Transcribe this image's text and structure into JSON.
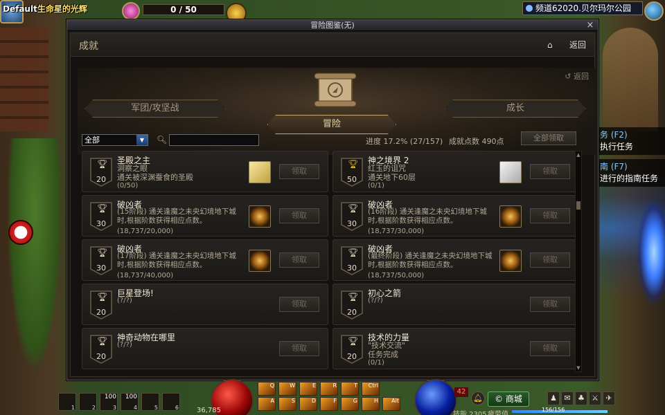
{
  "hud": {
    "player_prefix": "Default",
    "player_name": "生命星的光辉",
    "fatigue_counter": "0 / 50",
    "channel": "频道62020.贝尔玛尔公园",
    "quest_panel": {
      "title": "务 (F2)",
      "text": "执行任务"
    },
    "guide_panel": {
      "title": "南 (F7)",
      "text": "进行的指南任务"
    }
  },
  "window": {
    "title": "冒险图鉴(无)",
    "close": "×",
    "section_title": "成就",
    "back": "返回",
    "back_small": "返回",
    "tabs": {
      "left": "军团/攻坚战",
      "active": "冒险",
      "right": "成长"
    },
    "filter": {
      "selected": "全部",
      "search_placeholder": "",
      "progress": "进度 17.2% (27/157)",
      "points": "成就点数 490点",
      "claim_all": "全部领取"
    },
    "cards": [
      {
        "points": "20",
        "gold": false,
        "title": "圣殿之主",
        "desc": "洞察之眼\n通关被深渊蚕食的圣殿",
        "progress": "(0/50)",
        "reward": "box",
        "claim": "领取"
      },
      {
        "points": "50",
        "gold": true,
        "title": "神之境界 2",
        "desc": "红玉的诅咒\n通关地下60层",
        "progress": "(0/1)",
        "reward": "paper",
        "claim": "领取"
      },
      {
        "points": "30",
        "gold": false,
        "title": "破凶者",
        "desc": "(15阶段) 通关逢魔之未央幻境地下城时,根据阶数获得相应点数。",
        "progress": "(18,737/20,000)",
        "reward": "gear",
        "claim": "领取"
      },
      {
        "points": "30",
        "gold": false,
        "title": "破凶者",
        "desc": "(16阶段) 通关逢魔之未央幻境地下城时,根据阶数获得相应点数。",
        "progress": "(18,737/30,000)",
        "reward": "gear",
        "claim": "领取"
      },
      {
        "points": "30",
        "gold": false,
        "title": "破凶者",
        "desc": "(17阶段) 通关逢魔之未央幻境地下城时,根据阶数获得相应点数。",
        "progress": "(18,737/40,000)",
        "reward": "gear",
        "claim": "领取"
      },
      {
        "points": "30",
        "gold": false,
        "title": "破凶者",
        "desc": "(最终阶段) 通关逢魔之未央幻境地下城时,根据阶数获得相应点数。",
        "progress": "(18,737/50,000)",
        "reward": "gear",
        "claim": "领取"
      },
      {
        "points": "20",
        "gold": false,
        "title": "巨星登场!",
        "desc": "",
        "progress": "(?/?)",
        "reward": "",
        "claim": "领取"
      },
      {
        "points": "20",
        "gold": false,
        "title": "初心之箭",
        "desc": "",
        "progress": "(?/?)",
        "reward": "",
        "claim": "领取"
      },
      {
        "points": "20",
        "gold": false,
        "title": "神奇动物在哪里",
        "desc": "",
        "progress": "(?/?)",
        "reward": "",
        "claim": "领取"
      },
      {
        "points": "20",
        "gold": false,
        "title": "技术的力量",
        "desc": "\"技术交流\"\n任务完成",
        "progress": "(0/1)",
        "reward": "",
        "claim": "领取"
      }
    ]
  },
  "bottom_hud": {
    "slots": [
      {
        "qty": "",
        "key": "1"
      },
      {
        "qty": "",
        "key": "2"
      },
      {
        "qty": "100",
        "key": "3"
      },
      {
        "qty": "100",
        "key": "4"
      },
      {
        "qty": "",
        "key": "5"
      },
      {
        "qty": "",
        "key": "6"
      }
    ],
    "gold": "36,785",
    "level": "42",
    "mp_label": "技能 2305",
    "shop": "商城",
    "fatigue_label": "疲劳值",
    "fatigue_value": "156/156",
    "fatigue_fraction": 1.0,
    "skill_keys_top": [
      "Q",
      "W",
      "E",
      "R",
      "T",
      "Ctrl"
    ],
    "skill_keys_bottom": [
      "A",
      "S",
      "D",
      "F",
      "G",
      "H",
      "Alt"
    ],
    "skill_levels_top": [
      "",
      "50",
      "",
      "",
      "",
      ""
    ],
    "skill_levels_bottom": [
      "",
      "54",
      "43",
      "",
      "",
      "",
      "3"
    ]
  }
}
